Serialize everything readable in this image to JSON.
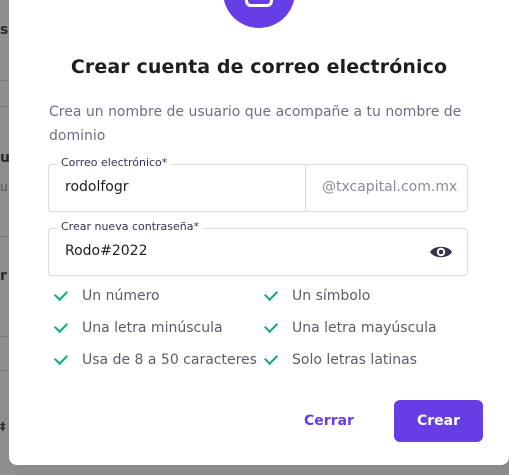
{
  "background": {
    "fragments": [
      "s",
      "u",
      "u",
      "r",
      "‡"
    ]
  },
  "modal": {
    "title": "Crear cuenta de correo electrónico",
    "description": "Crea un nombre de usuario que acompañe a tu nombre de dominio",
    "email": {
      "label": "Correo electrónico*",
      "value": "rodolfogr",
      "domain_suffix": "@txcapital.com.mx"
    },
    "password": {
      "label": "Crear nueva contraseña*",
      "value": "Rodo#2022",
      "toggle_icon": "eye-icon"
    },
    "requirements": [
      "Un número",
      "Un símbolo",
      "Una letra minúscula",
      "Una letra mayúscula",
      "Usa de 8 a 50 caracteres",
      "Solo letras latinas"
    ],
    "buttons": {
      "close_label": "Cerrar",
      "create_label": "Crear"
    }
  },
  "colors": {
    "accent": "#673de6",
    "check": "#00b090",
    "overlay": "#8c8c8c"
  }
}
